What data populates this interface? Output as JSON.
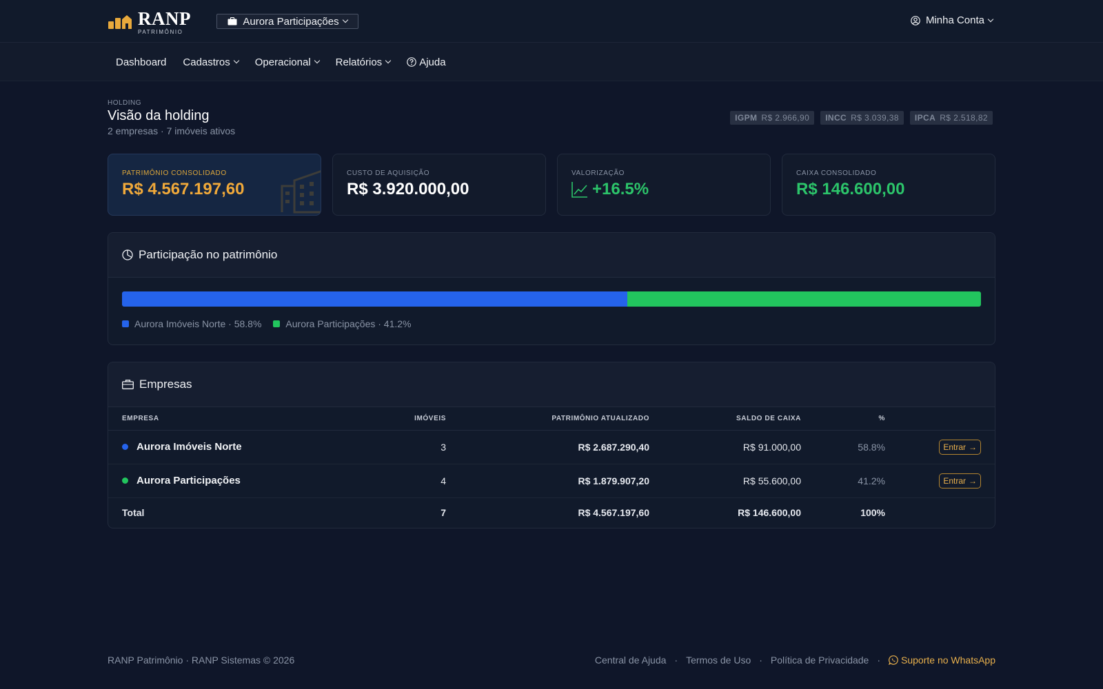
{
  "header": {
    "brand": "RANP",
    "brand_sub": "PATRIMÔNIO",
    "company_selector": "Aurora Participações",
    "account_label": "Minha Conta"
  },
  "nav": {
    "items": [
      {
        "label": "Dashboard",
        "dropdown": false
      },
      {
        "label": "Cadastros",
        "dropdown": true
      },
      {
        "label": "Operacional",
        "dropdown": true
      },
      {
        "label": "Relatórios",
        "dropdown": true
      },
      {
        "label": "Ajuda",
        "dropdown": false,
        "icon": "help-circle-icon"
      }
    ]
  },
  "page": {
    "eyebrow": "HOLDING",
    "title": "Visão da holding",
    "subtitle": "2 empresas · 7 imóveis ativos",
    "indices": [
      {
        "name": "IGPM",
        "value": "R$ 2.966,90"
      },
      {
        "name": "INCC",
        "value": "R$ 3.039,38"
      },
      {
        "name": "IPCA",
        "value": "R$ 2.518,82"
      }
    ]
  },
  "cards": [
    {
      "label": "PATRIMÔNIO CONSOLIDADO",
      "value": "R$ 4.567.197,60"
    },
    {
      "label": "CUSTO DE AQUISIÇÃO",
      "value": "R$ 3.920.000,00"
    },
    {
      "label": "VALORIZAÇÃO",
      "value": "+16.5%"
    },
    {
      "label": "CAIXA CONSOLIDADO",
      "value": "R$ 146.600,00"
    }
  ],
  "share": {
    "title": "Participação no patrimônio",
    "segments": [
      {
        "label": "Aurora Imóveis Norte · 58.8%",
        "percent": 58.8,
        "color": "#2563eb"
      },
      {
        "label": "Aurora Participações · 41.2%",
        "percent": 41.2,
        "color": "#22c55e"
      }
    ]
  },
  "companies": {
    "title": "Empresas",
    "columns": [
      "EMPRESA",
      "IMÓVEIS",
      "PATRIMÔNIO ATUALIZADO",
      "SALDO DE CAIXA",
      "%"
    ],
    "rows": [
      {
        "name": "Aurora Imóveis Norte",
        "imoveis": "3",
        "patrimonio": "R$ 2.687.290,40",
        "caixa": "R$ 91.000,00",
        "pct": "58.8%",
        "action": "Entrar",
        "color": "#2563eb"
      },
      {
        "name": "Aurora Participações",
        "imoveis": "4",
        "patrimonio": "R$ 1.879.907,20",
        "caixa": "R$ 55.600,00",
        "pct": "41.2%",
        "action": "Entrar",
        "color": "#22c55e"
      }
    ],
    "total": {
      "label": "Total",
      "imoveis": "7",
      "patrimonio": "R$ 4.567.197,60",
      "caixa": "R$ 146.600,00",
      "pct": "100%"
    }
  },
  "footer": {
    "copyright": "RANP Patrimônio · RANP Sistemas © 2026",
    "links": [
      "Central de Ajuda",
      "Termos de Uso",
      "Política de Privacidade"
    ],
    "support": "Suporte no WhatsApp"
  }
}
